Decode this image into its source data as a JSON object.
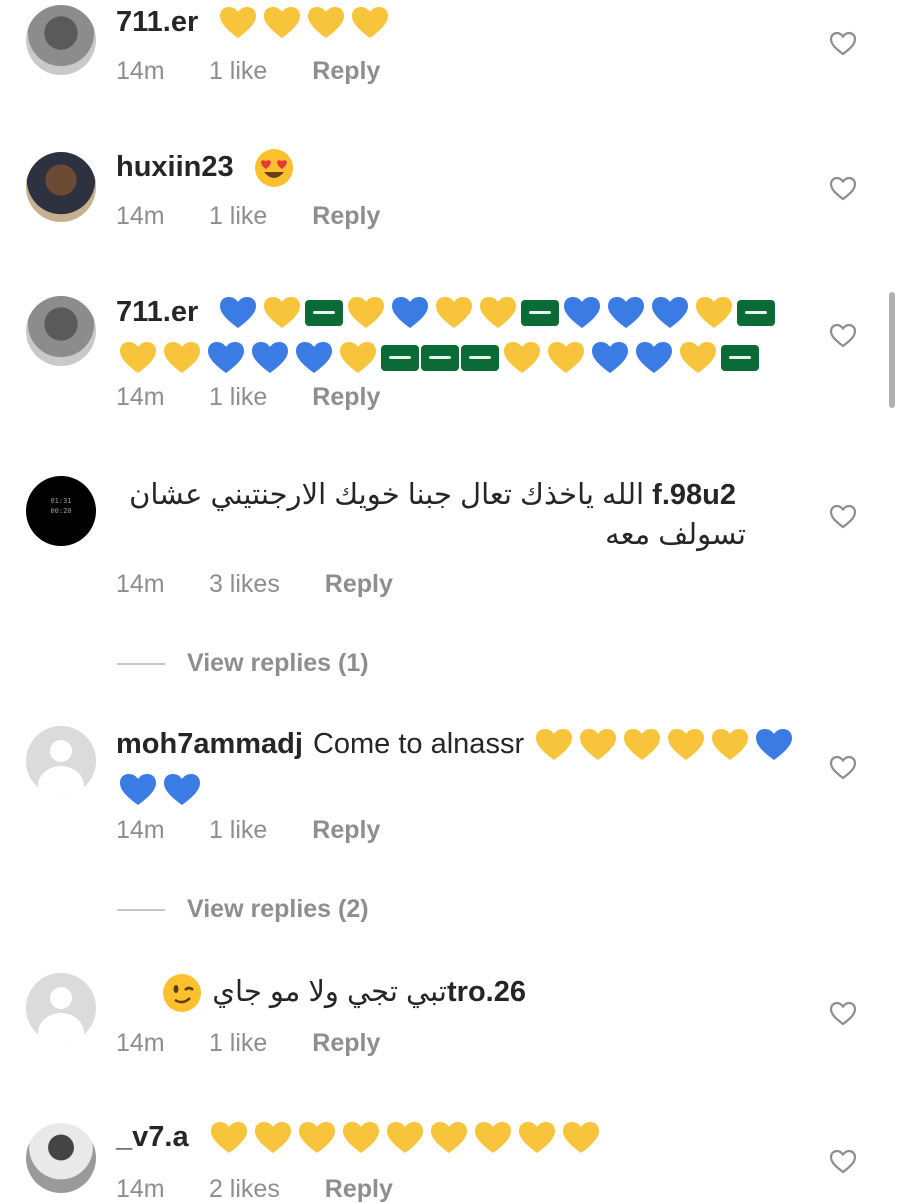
{
  "colors": {
    "yellow_heart": "#f7c43c",
    "blue_heart": "#3a7ce3",
    "saudi_flag": "#0a6b37",
    "muted_text": "#8e8e8e"
  },
  "comments": [
    {
      "user": "711.er",
      "text": "",
      "emojis": [
        "yellow-heart",
        "yellow-heart",
        "yellow-heart",
        "yellow-heart"
      ],
      "time": "14m",
      "likes": "1 like",
      "reply": "Reply",
      "avatar": "photo"
    },
    {
      "user": "huxiin23",
      "text": "",
      "emojis": [
        "heart-eyes"
      ],
      "time": "14m",
      "likes": "1 like",
      "reply": "Reply",
      "avatar": "photo2"
    },
    {
      "user": "711.er",
      "text": "",
      "emojis": [
        "blue-heart",
        "yellow-heart",
        "saudi-flag",
        "yellow-heart",
        "blue-heart",
        "yellow-heart",
        "yellow-heart",
        "saudi-flag",
        "blue-heart",
        "blue-heart",
        "blue-heart",
        "yellow-heart",
        "saudi-flag",
        "yellow-heart",
        "yellow-heart",
        "blue-heart",
        "blue-heart",
        "blue-heart",
        "yellow-heart",
        "saudi-flag",
        "saudi-flag",
        "saudi-flag",
        "yellow-heart",
        "yellow-heart",
        "blue-heart",
        "blue-heart",
        "yellow-heart",
        "saudi-flag"
      ],
      "time": "14m",
      "likes": "1 like",
      "reply": "Reply",
      "avatar": "photo"
    },
    {
      "user": "f.98u2",
      "text": "الله ياخذك تعال جبنا خويك الارجنتيني عشان تسولف معه",
      "emojis": [],
      "time": "14m",
      "likes": "3 likes",
      "reply": "Reply",
      "avatar": "black",
      "avatar_text": [
        "01:31",
        "00:20"
      ],
      "view_replies": "View replies (1)"
    },
    {
      "user": "moh7ammadj",
      "text": "Come to alnassr",
      "emojis": [
        "yellow-heart",
        "yellow-heart",
        "yellow-heart",
        "yellow-heart",
        "yellow-heart",
        "blue-heart",
        "blue-heart",
        "blue-heart"
      ],
      "time": "14m",
      "likes": "1 like",
      "reply": "Reply",
      "avatar": "default",
      "view_replies": "View replies (2)"
    },
    {
      "user": "tro.26",
      "text": "تبي تجي ولا مو جاي",
      "emojis": [
        "wink"
      ],
      "time": "14m",
      "likes": "1 like",
      "reply": "Reply",
      "avatar": "default"
    },
    {
      "user": "_v7.a",
      "text": "",
      "emojis": [
        "yellow-heart",
        "yellow-heart",
        "yellow-heart",
        "yellow-heart",
        "yellow-heart",
        "yellow-heart",
        "yellow-heart",
        "yellow-heart",
        "yellow-heart"
      ],
      "time": "14m",
      "likes": "2 likes",
      "reply": "Reply",
      "avatar": "team"
    }
  ]
}
